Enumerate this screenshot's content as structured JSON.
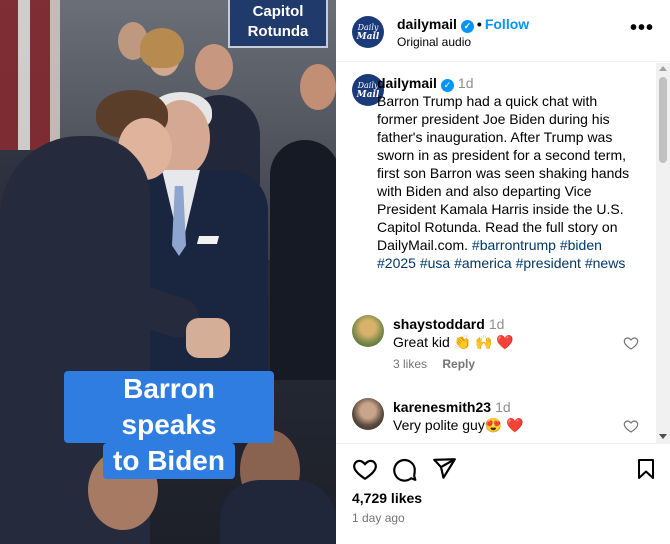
{
  "video": {
    "sign_line1": "Capitol",
    "sign_line2": "Rotunda",
    "caption_line1": "Barron speaks",
    "caption_line2": "to Biden"
  },
  "header": {
    "username": "dailymail",
    "follow_label": "Follow",
    "subtitle": "Original audio",
    "avatar_line1": "Daily",
    "avatar_line2": "Mail"
  },
  "post": {
    "username": "dailymail",
    "time": "1d",
    "text": "Barron Trump had a quick chat with former president Joe Biden during his father's inauguration. After Trump was sworn in as president for a second term, first son Barron was seen shaking hands with Biden and also departing Vice President Kamala Harris inside the U.S. Capitol Rotunda. Read the full story on DailyMail.com.",
    "hashtags": [
      "#barrontrump",
      "#biden",
      "#2025",
      "#usa",
      "#america",
      "#president",
      "#news"
    ]
  },
  "comments": [
    {
      "user": "shaystoddard",
      "time": "1d",
      "text": "Great kid 👏 🙌 ❤️",
      "likes": "3 likes",
      "reply": "Reply"
    },
    {
      "user": "karenesmith23",
      "time": "1d",
      "text": "Very polite guy😍 ❤️"
    }
  ],
  "footer": {
    "likes": "4,729 likes",
    "ago": "1 day ago"
  },
  "colors": {
    "accent": "#0095f6",
    "hashtag": "#00376b",
    "caption_bg": "#2f7de1"
  }
}
